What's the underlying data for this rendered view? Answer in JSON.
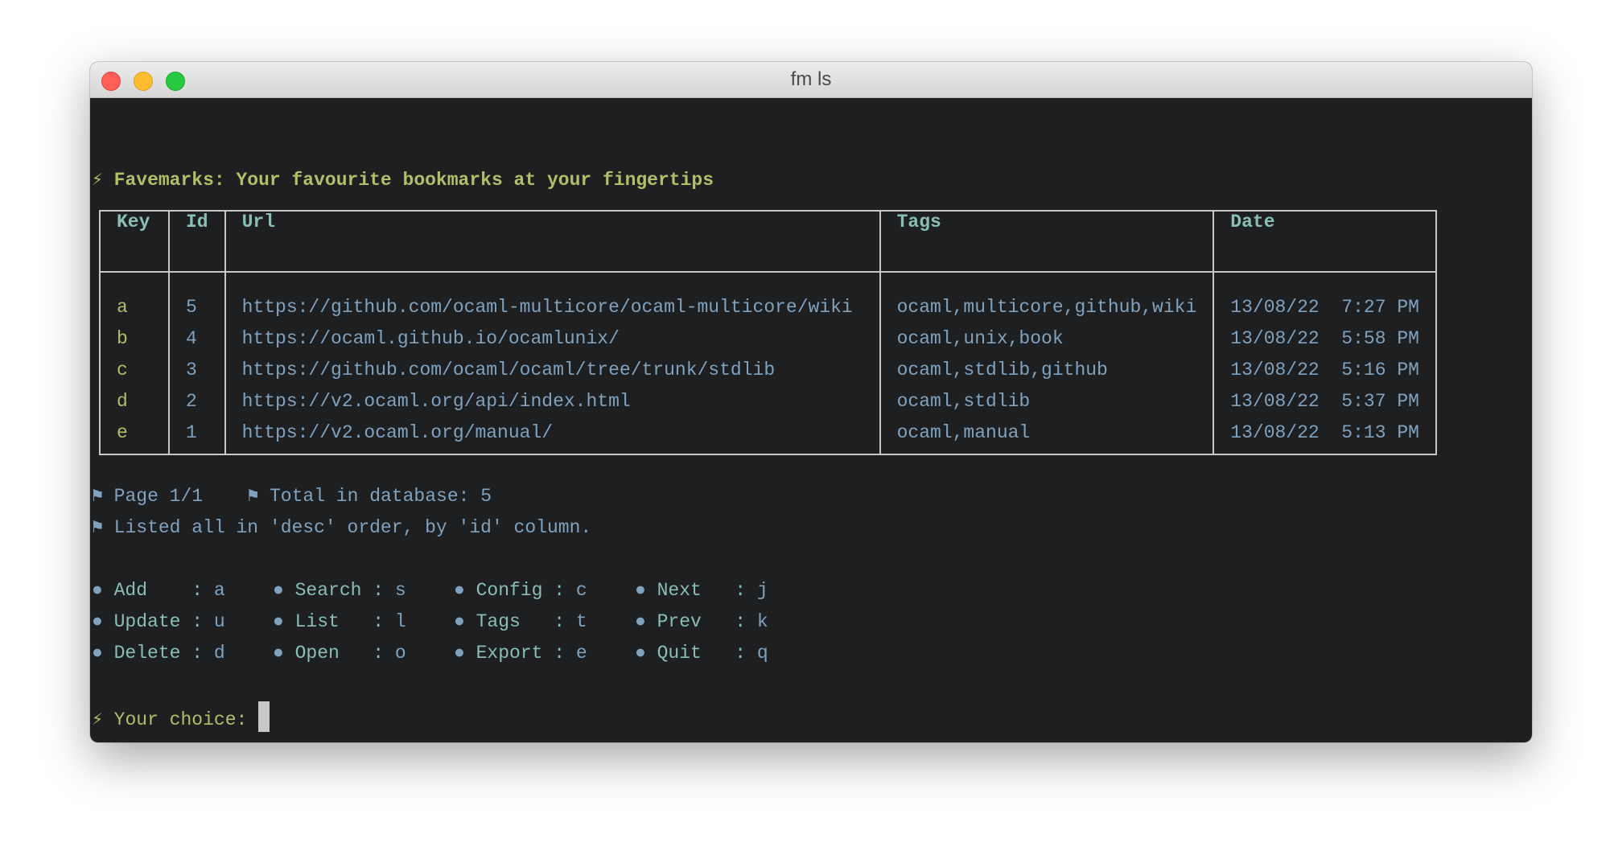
{
  "window": {
    "title": "fm ls"
  },
  "header": {
    "icon": "lightning-bolt-icon",
    "text": "Favemarks: Your favourite bookmarks at your fingertips"
  },
  "table": {
    "columns": [
      "Key",
      "Id",
      "Url",
      "Tags",
      "Date"
    ],
    "rows": [
      {
        "key": "a",
        "id": "5",
        "url": "https://github.com/ocaml-multicore/ocaml-multicore/wiki",
        "tags": "ocaml,multicore,github,wiki",
        "date": "13/08/22  7:27 PM"
      },
      {
        "key": "b",
        "id": "4",
        "url": "https://ocaml.github.io/ocamlunix/",
        "tags": "ocaml,unix,book",
        "date": "13/08/22  5:58 PM"
      },
      {
        "key": "c",
        "id": "3",
        "url": "https://github.com/ocaml/ocaml/tree/trunk/stdlib",
        "tags": "ocaml,stdlib,github",
        "date": "13/08/22  5:16 PM"
      },
      {
        "key": "d",
        "id": "2",
        "url": "https://v2.ocaml.org/api/index.html",
        "tags": "ocaml,stdlib",
        "date": "13/08/22  5:37 PM"
      },
      {
        "key": "e",
        "id": "1",
        "url": "https://v2.ocaml.org/manual/",
        "tags": "ocaml,manual",
        "date": "13/08/22  5:13 PM"
      }
    ]
  },
  "status": {
    "page": "Page 1/1",
    "total": "Total in database: 5",
    "listed": "Listed all in 'desc' order, by 'id' column.",
    "icon": "flag-icon"
  },
  "menu": [
    [
      {
        "label": "Add   ",
        "key": "a"
      },
      {
        "label": "Search",
        "key": "s"
      },
      {
        "label": "Config",
        "key": "c"
      },
      {
        "label": "Next  ",
        "key": "j"
      }
    ],
    [
      {
        "label": "Update",
        "key": "u"
      },
      {
        "label": "List  ",
        "key": "l"
      },
      {
        "label": "Tags  ",
        "key": "t"
      },
      {
        "label": "Prev  ",
        "key": "k"
      }
    ],
    [
      {
        "label": "Delete",
        "key": "d"
      },
      {
        "label": "Open  ",
        "key": "o"
      },
      {
        "label": "Export",
        "key": "e"
      },
      {
        "label": "Quit  ",
        "key": "q"
      }
    ]
  ],
  "prompt": {
    "text": "Your choice:",
    "value": ""
  },
  "colors": {
    "background": "#1d1f21",
    "yellow": "#b5bd68",
    "teal": "#8abeb7",
    "blue": "#81a2be"
  }
}
